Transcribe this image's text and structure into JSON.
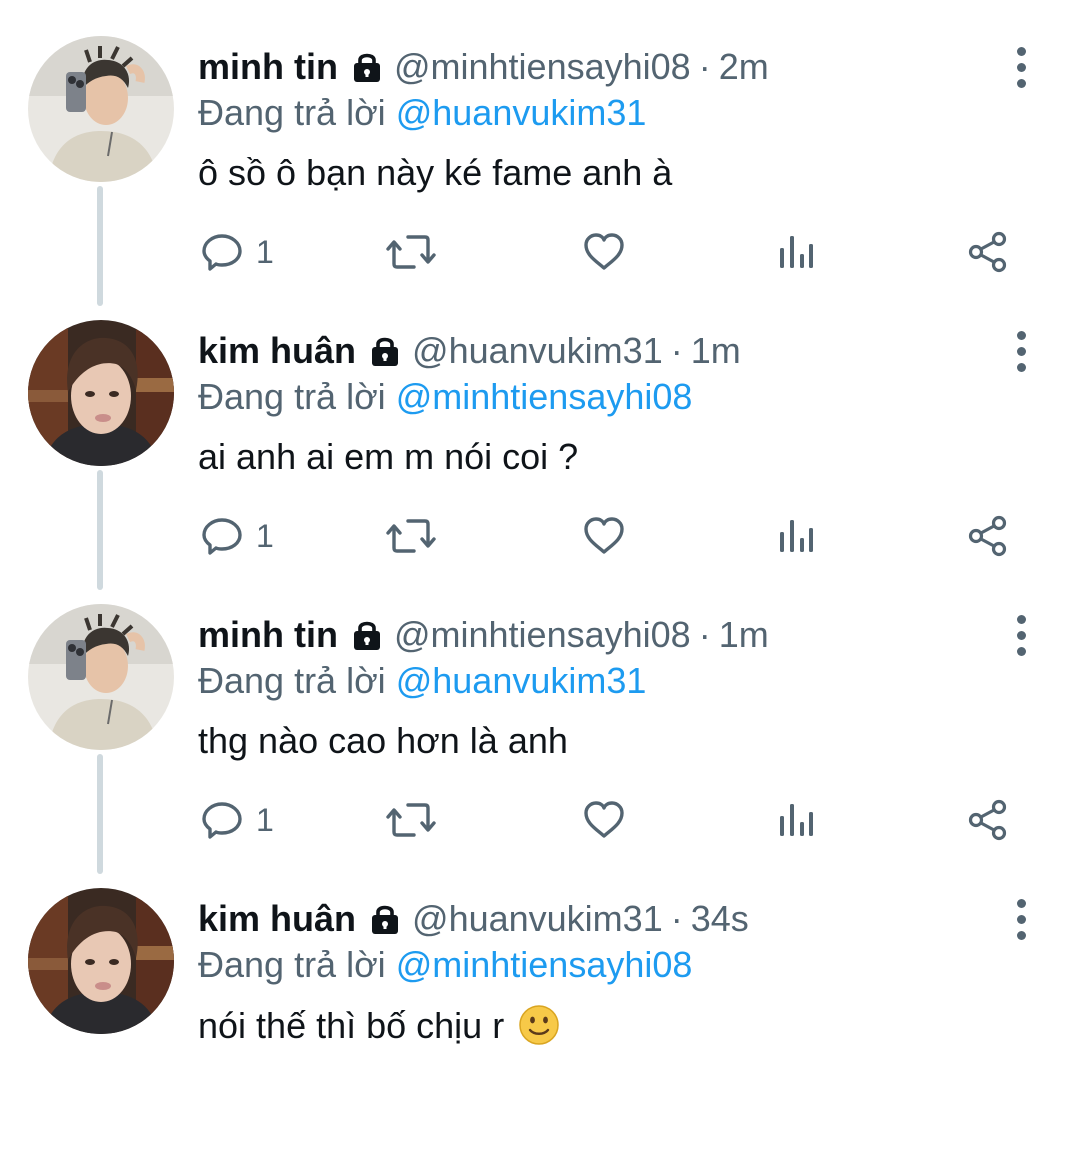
{
  "tweets": [
    {
      "name": "minh tin",
      "handle": "@minhtiensayhi08",
      "separator": "·",
      "time": "2m",
      "reply_prefix": "Đang trả lời",
      "reply_to": "@huanvukim31",
      "text": "ô sồ ô bạn này ké fame anh à",
      "reply_count": "1",
      "avatar": "minh-tin-avatar",
      "protected": true
    },
    {
      "name": "kim huân",
      "handle": "@huanvukim31",
      "separator": "·",
      "time": "1m",
      "reply_prefix": "Đang trả lời",
      "reply_to": "@minhtiensayhi08",
      "text": "ai anh ai em m nói coi ?",
      "reply_count": "1",
      "avatar": "kim-huan-avatar",
      "protected": true
    },
    {
      "name": "minh tin",
      "handle": "@minhtiensayhi08",
      "separator": "·",
      "time": "1m",
      "reply_prefix": "Đang trả lời",
      "reply_to": "@huanvukim31",
      "text": "thg nào cao hơn là anh",
      "reply_count": "1",
      "avatar": "minh-tin-avatar",
      "protected": true
    },
    {
      "name": "kim huân",
      "handle": "@huanvukim31",
      "separator": "·",
      "time": "34s",
      "reply_prefix": "Đang trả lời",
      "reply_to": "@minhtiensayhi08",
      "text": "nói thế thì bố chịu r",
      "text_emoji": "slightly-smiling-face",
      "avatar": "kim-huan-avatar",
      "protected": true
    }
  ],
  "icons": {
    "reply": "reply-icon",
    "retweet": "retweet-icon",
    "like": "like-icon",
    "views": "views-icon",
    "share": "share-icon",
    "more": "more-options-icon",
    "lock": "lock-icon"
  },
  "colors": {
    "text": "#0f1419",
    "secondary": "#536471",
    "mention": "#1d9bf0",
    "thread_line": "#cfd9de"
  }
}
